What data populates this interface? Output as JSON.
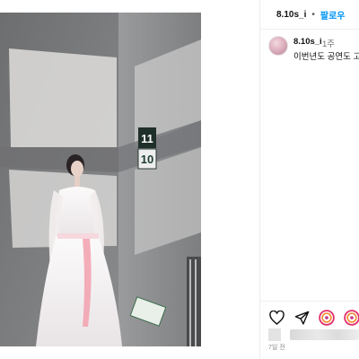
{
  "post": {
    "username": "8.10s_i",
    "separator": "•",
    "follow_label": "팔로우",
    "date": "7일 전"
  },
  "comment": {
    "username": "8.10s_i",
    "time": "1주",
    "text": "이번년도 공연도 고"
  },
  "photo": {
    "sign_top": "11",
    "sign_bottom": "10"
  },
  "actions": {
    "icons": [
      "heart-icon",
      "share-icon",
      "reel-icon",
      "reel-icon-2"
    ]
  },
  "colors": {
    "accent": "#0095f6",
    "wall": "#8c8d8f",
    "dress": "#f4f1f2",
    "sash": "#f2a0ae"
  }
}
